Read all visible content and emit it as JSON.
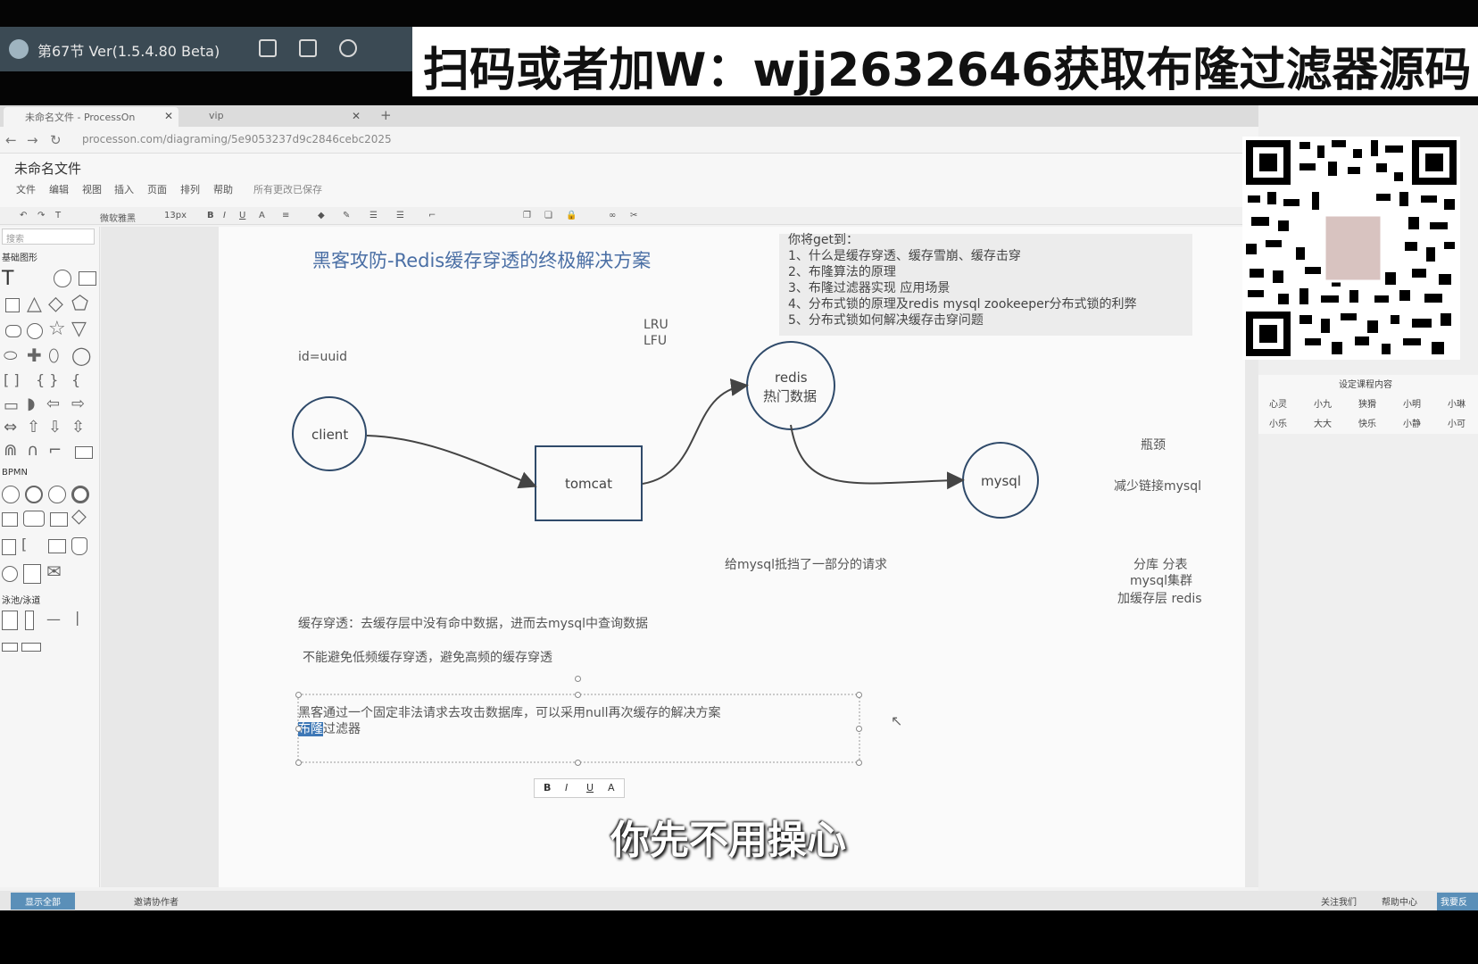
{
  "player": {
    "title": "第67节 Ver(1.5.4.80 Beta)",
    "banner": "扫码或者加W：wjj2632646获取布隆过滤器源码"
  },
  "browser": {
    "tabs": [
      {
        "label": "未命名文件 - ProcessOn",
        "active": true
      },
      {
        "label": "vip",
        "active": false
      }
    ],
    "new_tab": "+",
    "url": "processon.com/diagraming/5e9053237d9c2846cebc2025"
  },
  "app": {
    "file_name": "未命名文件",
    "menu": [
      "文件",
      "编辑",
      "视图",
      "插入",
      "页面",
      "排列",
      "帮助"
    ],
    "save_status": "所有更改已保存",
    "toolbar": {
      "font": "微软雅黑",
      "size": "13px"
    },
    "left_panel": {
      "search_placeholder": "搜索",
      "section_basic": "基础图形",
      "section_bpmn": "BPMN",
      "section_lanes": "泳池/泳道"
    },
    "status": {
      "left": "显示全部",
      "invite": "邀请协作者",
      "follow": "关注我们",
      "help": "帮助中心",
      "feedback": "我要反馈"
    }
  },
  "diagram": {
    "title": "黑客攻防-Redis缓存穿透的终极解决方案",
    "tips": [
      "你将get到：",
      "1、什么是缓存穿透、缓存雪崩、缓存击穿",
      "2、布隆算法的原理",
      "3、布隆过滤器实现 应用场景",
      "4、分布式锁的原理及redis mysql zookeeper分布式锁的利弊",
      "5、分布式锁如何解决缓存击穿问题"
    ],
    "lru": "LRU",
    "lfu": "LFU",
    "id_note": "id=uuid",
    "nodes": {
      "client": "client",
      "tomcat": "tomcat",
      "redis_line1": "redis",
      "redis_line2": "热门数据",
      "mysql": "mysql"
    },
    "bottleneck": "瓶颈",
    "reduce": "减少链接mysql",
    "mysql_block": "给mysql抵挡了一部分的请求",
    "scale": [
      "分库  分表",
      "mysql集群",
      "加缓存层 redis"
    ],
    "penetration": "缓存穿透：去缓存层中没有命中数据，进而去mysql中查询数据",
    "avoid": "不能避免低频缓存穿透，避免高频的缓存穿透",
    "hacker_line1": "黑客通过一个固定非法请求去攻击数据库，可以采用null再次缓存的解决方案",
    "hacker_line2_sel": "布隆",
    "hacker_line2_rest": "过滤器"
  },
  "side": {
    "table_title": "设定课程内容",
    "row1": [
      "心灵",
      "小九",
      "狭猾",
      "小明",
      "小琳"
    ],
    "row2": [
      "小乐",
      "大大",
      "快乐",
      "小静",
      "小可"
    ]
  },
  "mini_toolbar": [
    "B",
    "I",
    "U",
    "A"
  ],
  "subtitle": "你先不用操心"
}
